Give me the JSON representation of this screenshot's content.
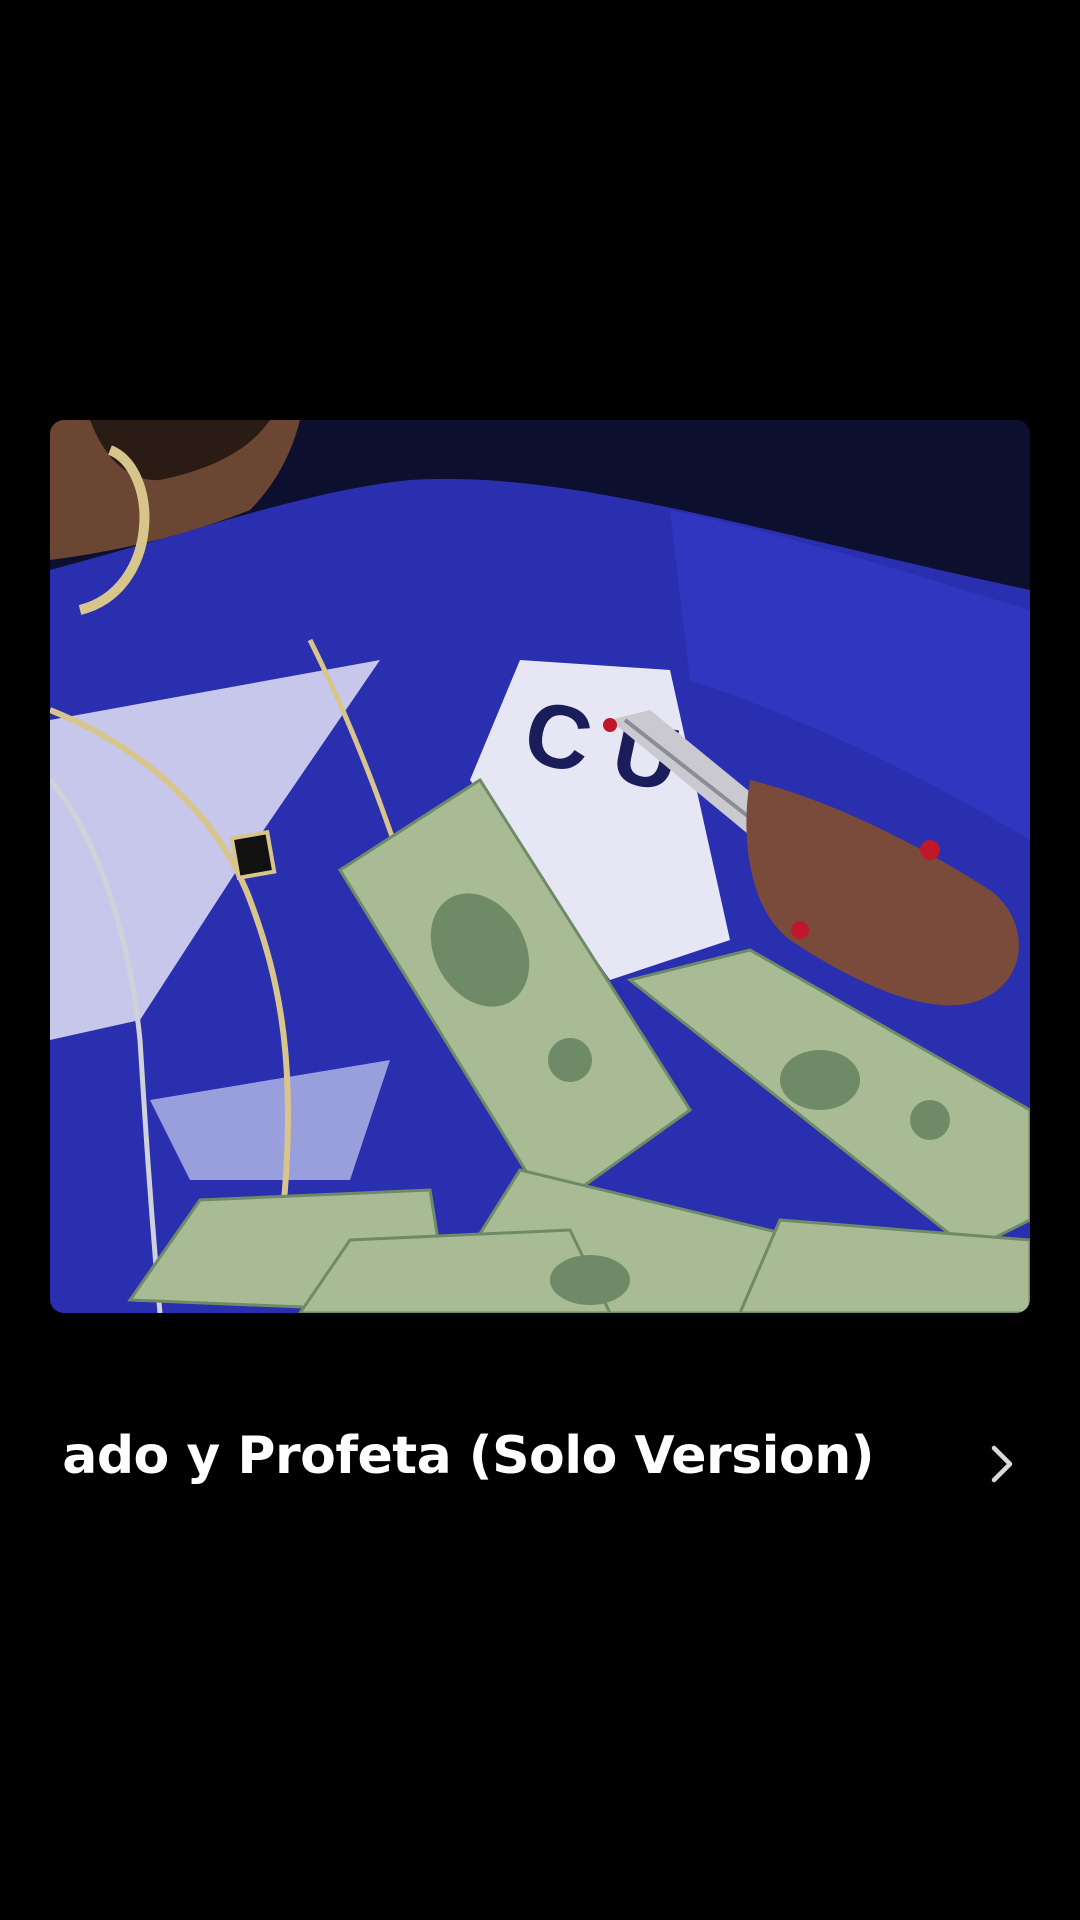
{
  "now_playing": {
    "title": "ado y Profeta (Solo Version)",
    "artwork": {
      "icon": "album-artwork",
      "colors": {
        "sweater": "#2a2fb0",
        "sweater_shadow": "#161a6e",
        "stripe": "#d8d8f2",
        "cash": "#a9bb94",
        "cash_dark": "#6f8a66",
        "chain": "#d8c58c",
        "skin": "#6b4633"
      }
    },
    "chevron_icon": "chevron-right-icon"
  },
  "colors": {
    "background": "#000000",
    "text": "#ffffff",
    "chevron": "#d9d9d9"
  }
}
